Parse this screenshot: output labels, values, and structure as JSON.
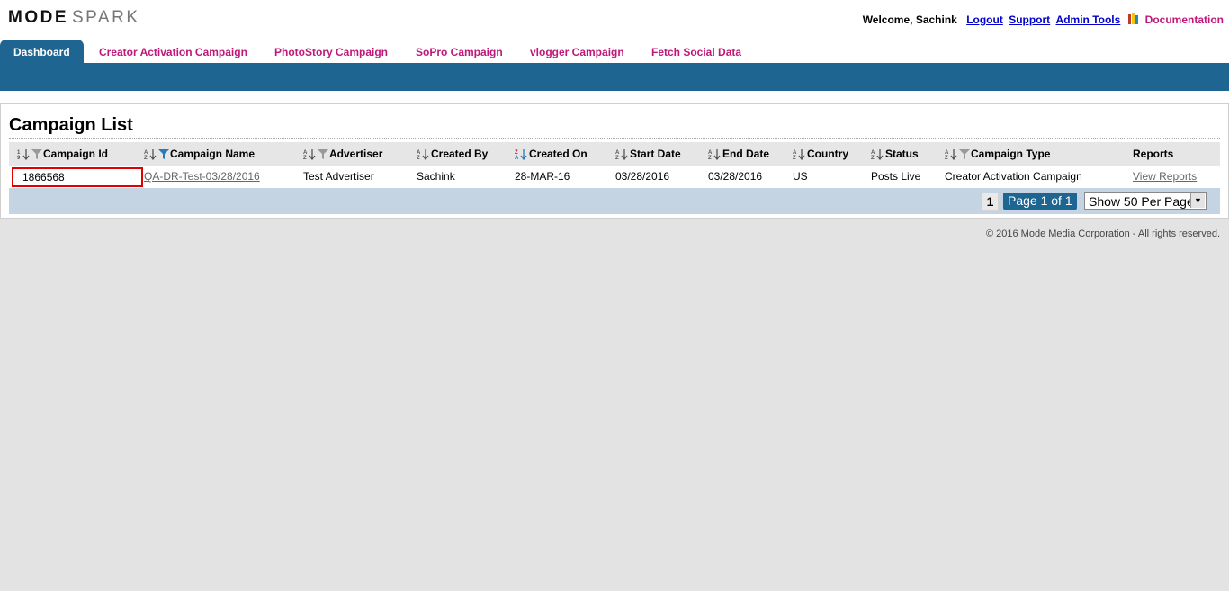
{
  "brand": {
    "logo_bold": "MODE",
    "logo_light": "SPARK"
  },
  "header": {
    "welcome": "Welcome, Sachink",
    "links": {
      "logout": "Logout",
      "support": "Support",
      "admin_tools": "Admin Tools",
      "documentation": "Documentation"
    },
    "documentation_icon": "books-icon"
  },
  "tabs": [
    {
      "label": "Dashboard",
      "active": true
    },
    {
      "label": "Creator Activation Campaign"
    },
    {
      "label": "PhotoStory Campaign"
    },
    {
      "label": "SoPro Campaign"
    },
    {
      "label": "vlogger Campaign"
    },
    {
      "label": "Fetch Social Data"
    }
  ],
  "campaign_list": {
    "title": "Campaign List",
    "columns": [
      {
        "label": "Campaign Id",
        "icons": [
          "sort-numeric-icon",
          "filter-icon"
        ]
      },
      {
        "label": "Campaign Name",
        "icons": [
          "sort-alpha-icon",
          "filter-active-icon"
        ]
      },
      {
        "label": "Advertiser",
        "icons": [
          "sort-alpha-icon",
          "filter-icon"
        ]
      },
      {
        "label": "Created By",
        "icons": [
          "sort-alpha-icon"
        ]
      },
      {
        "label": "Created On",
        "icons": [
          "sort-desc-active-icon"
        ]
      },
      {
        "label": "Start Date",
        "icons": [
          "sort-alpha-icon"
        ]
      },
      {
        "label": "End Date",
        "icons": [
          "sort-alpha-icon"
        ]
      },
      {
        "label": "Country",
        "icons": [
          "sort-alpha-icon"
        ]
      },
      {
        "label": "Status",
        "icons": [
          "sort-alpha-icon"
        ]
      },
      {
        "label": "Campaign Type",
        "icons": [
          "sort-alpha-icon",
          "filter-icon"
        ]
      },
      {
        "label": "Reports",
        "icons": []
      }
    ],
    "rows": [
      {
        "campaign_id": "1866568",
        "campaign_name": "QA-DR-Test-03/28/2016",
        "advertiser": "Test Advertiser",
        "created_by": "Sachink",
        "created_on": "28-MAR-16",
        "start_date": "03/28/2016",
        "end_date": "03/28/2016",
        "country": "US",
        "status": "Posts Live",
        "campaign_type": "Creator Activation Campaign",
        "reports": "View Reports"
      }
    ],
    "pagination": {
      "current_page": "1",
      "page_info": "Page 1 of 1",
      "per_page": "Show 50 Per Page"
    }
  },
  "colors": {
    "brand_blue": "#1f6592",
    "tab_magenta": "#c0177a",
    "link_blue": "#0000cc",
    "selection_red": "#e00000"
  },
  "footer": {
    "copyright": "© 2016 Mode Media Corporation - All rights reserved."
  }
}
